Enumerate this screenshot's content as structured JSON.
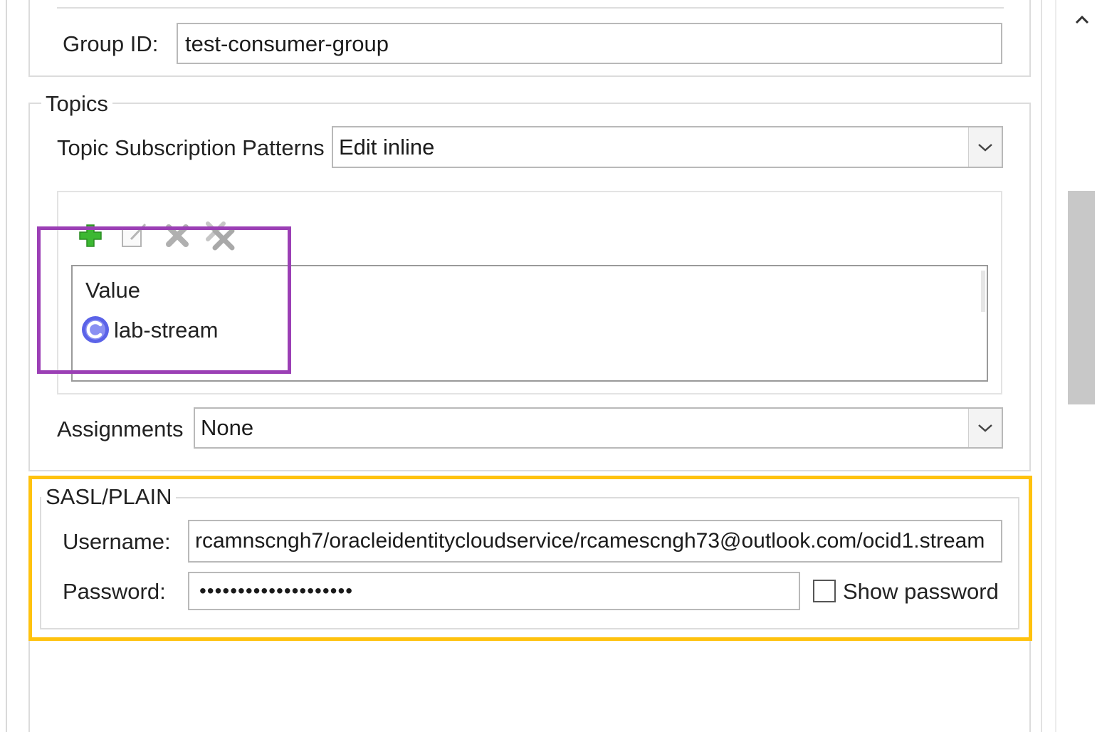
{
  "consumer": {
    "group_id_label": "Group ID:",
    "group_id_value": "test-consumer-group"
  },
  "topics": {
    "legend": "Topics",
    "subscription_patterns_label": "Topic Subscription Patterns",
    "subscription_patterns_value": "Edit inline",
    "toolbar": {
      "add_icon": "add-icon",
      "edit_icon": "edit-icon",
      "delete_icon": "delete-icon",
      "delete_all_icon": "delete-all-icon"
    },
    "table": {
      "column_header": "Value",
      "rows": [
        {
          "value": "lab-stream",
          "icon": "value-icon"
        }
      ]
    },
    "assignments_label": "Assignments",
    "assignments_value": "None"
  },
  "sasl": {
    "legend": "SASL/PLAIN",
    "username_label": "Username:",
    "username_value": "rcamnscngh7/oracleidentitycloudservice/rcamescngh73@outlook.com/ocid1.stream",
    "password_label": "Password:",
    "password_value": "••••••••••••••••••••",
    "show_password_label": "Show password",
    "show_password_checked": false
  },
  "colors": {
    "highlight_purple": "#9b3fb5",
    "highlight_yellow": "#ffc20e",
    "add_green": "#3cb832",
    "value_icon_blue": "#5b63e8"
  }
}
